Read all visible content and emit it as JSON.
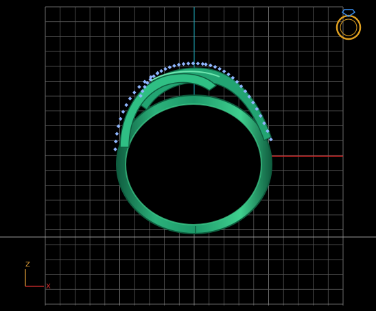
{
  "viewport": {
    "background": "#000000",
    "grid_color": "#5a5a5a",
    "grid_major_color": "#8a8a8a",
    "vertical_axis_color": "#1fb3c4",
    "horizontal_axis_color": "#c21e1e"
  },
  "model": {
    "metal_color": "#1e9a6a",
    "metal_highlight": "#3fd08f",
    "metal_shadow": "#0f5d3f",
    "stone_color": "#8fb6ff"
  },
  "view_cube": {
    "icon": "ring-icon",
    "color": "#e0a020",
    "gem_color": "#3a8ff0"
  },
  "axis_gizmo": {
    "z_label": "Z",
    "x_label": "X",
    "z_color": "#e8a53a",
    "x_color": "#e03030"
  }
}
